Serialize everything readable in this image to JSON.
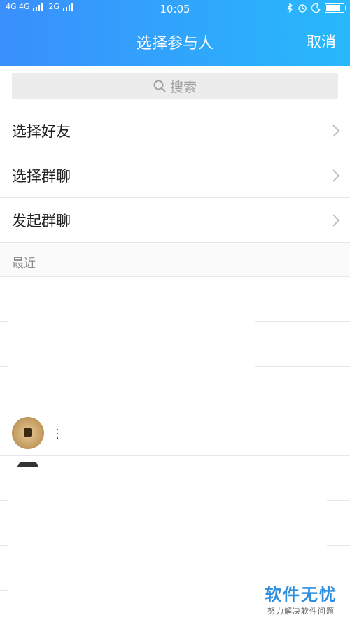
{
  "status_bar": {
    "signal_left": "4G 4G",
    "signal_right": "2G",
    "time": "10:05",
    "icons": [
      "bluetooth-icon",
      "alarm-icon",
      "moon-icon",
      "battery-icon"
    ]
  },
  "header": {
    "title": "选择参与人",
    "cancel_label": "取消"
  },
  "search": {
    "placeholder": "搜索"
  },
  "menu": {
    "items": [
      {
        "label": "选择好友"
      },
      {
        "label": "选择群聊"
      },
      {
        "label": "发起群聊"
      }
    ]
  },
  "recent": {
    "section_label": "最近"
  },
  "watermark": {
    "title": "软件无忧",
    "subtitle": "努力解决软件问题"
  },
  "colors": {
    "header_start": "#3a8ffc",
    "header_end": "#27b9fb",
    "watermark": "#2d8fe0"
  }
}
